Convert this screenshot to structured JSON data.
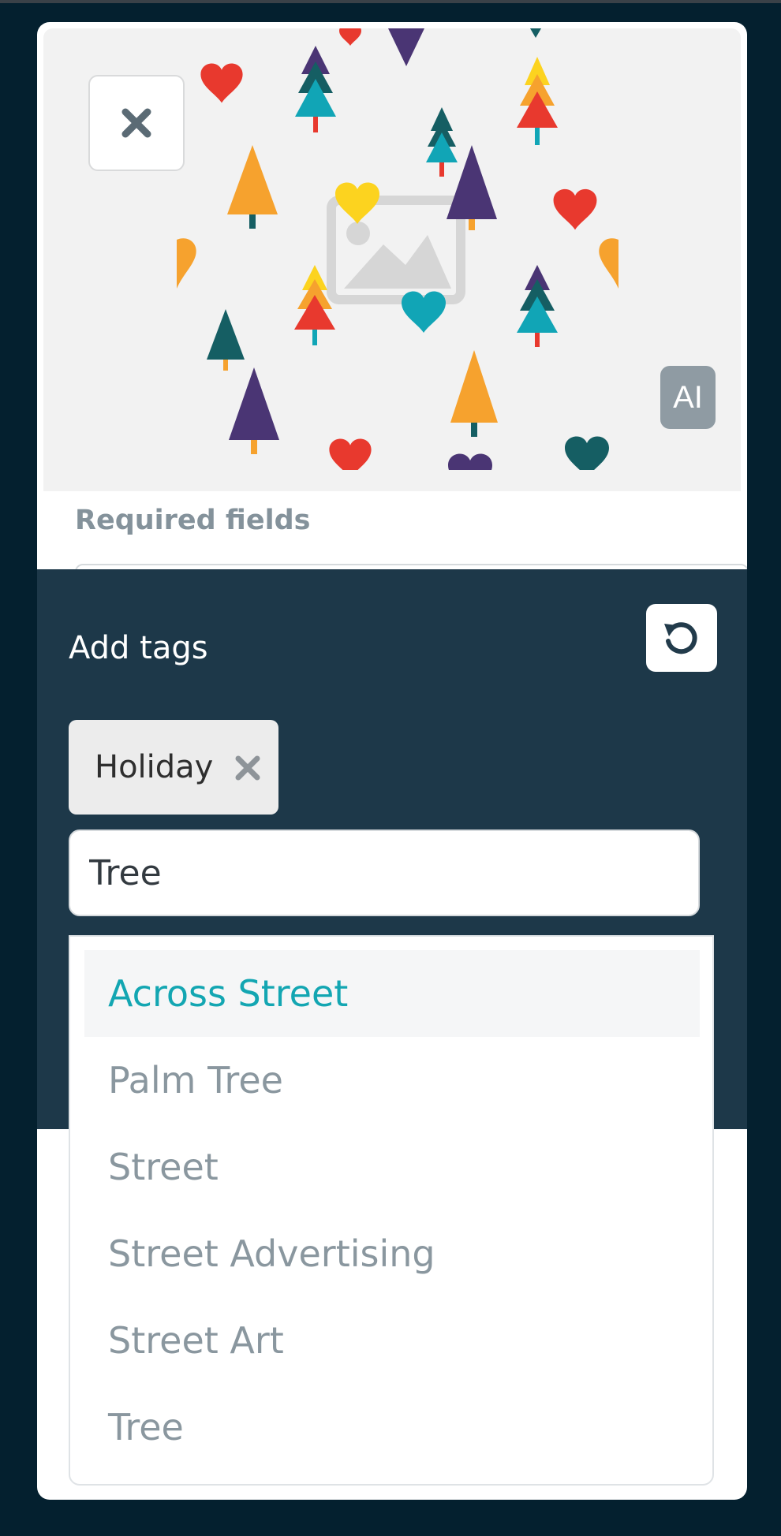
{
  "preview": {
    "close_icon": "close-icon",
    "badge_label": "AI",
    "placeholder_icon": "image-placeholder-icon"
  },
  "form": {
    "required_label": "Required fields"
  },
  "tags": {
    "title": "Add tags",
    "reset_icon": "reset-icon",
    "chips": [
      {
        "label": "Holiday",
        "remove_icon": "remove-tag-icon"
      }
    ],
    "input_value": "Tree",
    "options": [
      {
        "label": "Across Street",
        "highlighted": true
      },
      {
        "label": "Palm Tree",
        "highlighted": false
      },
      {
        "label": "Street",
        "highlighted": false
      },
      {
        "label": "Street Advertising",
        "highlighted": false
      },
      {
        "label": "Street Art",
        "highlighted": false
      },
      {
        "label": "Tree",
        "highlighted": false
      }
    ]
  },
  "colors": {
    "background": "#04202f",
    "panel": "#1d3849",
    "accent": "#13a6b2",
    "muted_text": "#8a979f"
  }
}
